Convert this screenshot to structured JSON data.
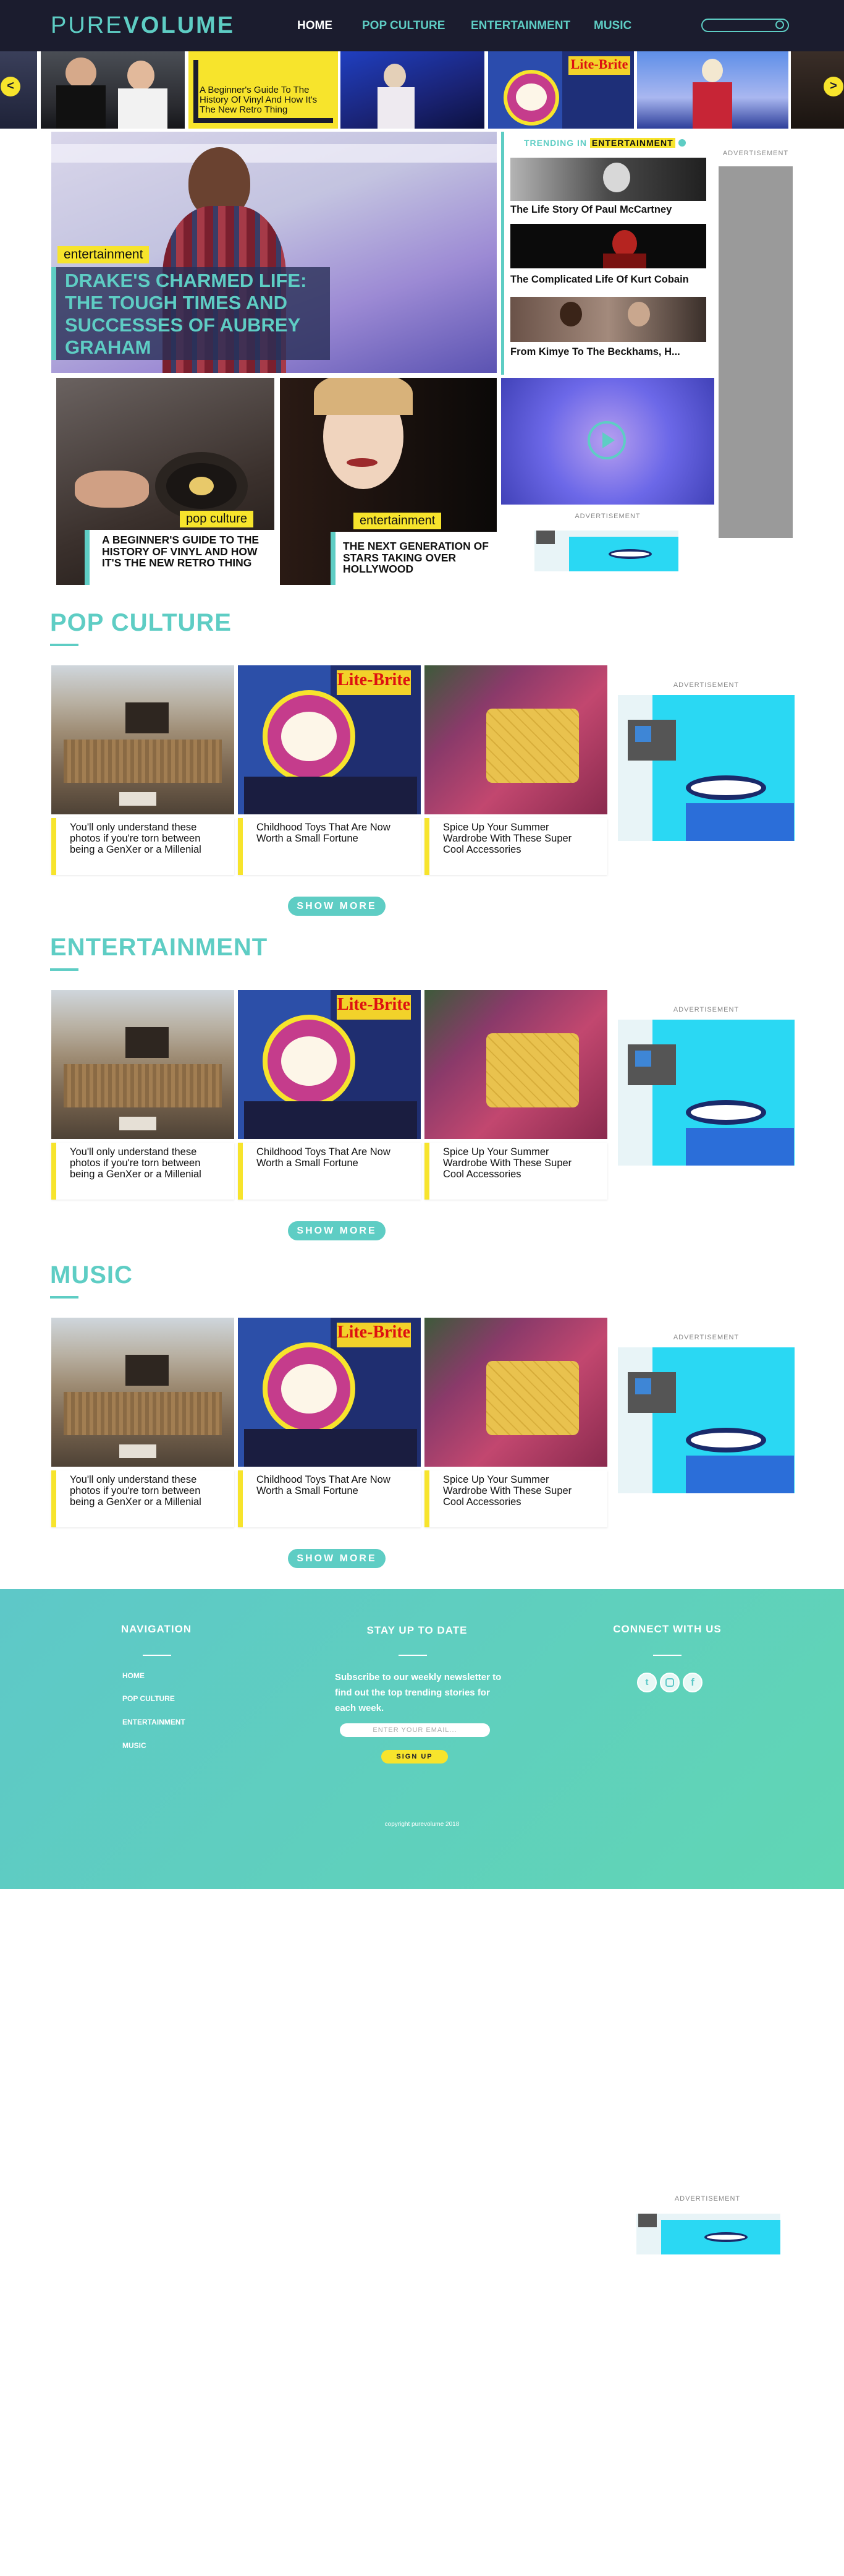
{
  "header": {
    "logo_light": "PURE",
    "logo_bold": "VOLUME",
    "nav": [
      "HOME",
      "POP CULTURE",
      "ENTERTAINMENT",
      "MUSIC"
    ]
  },
  "carousel": {
    "caption": "A Beginner's Guide To The History Of Vinyl And How It's The New Retro Thing",
    "prev": "<",
    "next": ">"
  },
  "hero": {
    "tag": "entertainment",
    "title": "DRAKE'S CHARMED LIFE: THE TOUGH TIMES AND SUCCESSES OF AUBREY GRAHAM"
  },
  "trending": {
    "prefix": "TRENDING IN",
    "category": "ENTERTAINMENT",
    "items": [
      "The Life Story Of Paul McCartney",
      "The Complicated Life Of Kurt Cobain",
      "From Kimye To The Beckhams, H..."
    ]
  },
  "features": [
    {
      "tag": "pop culture",
      "title": "A BEGINNER'S GUIDE TO THE HISTORY OF VINYL AND HOW IT'S THE NEW RETRO THING"
    },
    {
      "tag": "entertainment",
      "title": "THE NEXT GENERATION OF STARS TAKING OVER HOLLYWOOD"
    }
  ],
  "ad_label": "ADVERTISEMENT",
  "sections": [
    {
      "title": "POP CULTURE",
      "cards": [
        "You'll only understand these photos if you're torn between being a GenXer or a Millenial",
        "Childhood Toys That Are Now Worth a Small Fortune",
        "Spice Up Your Summer Wardrobe With These Super Cool Accessories"
      ],
      "more": "SHOW MORE"
    },
    {
      "title": "ENTERTAINMENT",
      "cards": [
        "You'll only understand these photos if you're torn between being a GenXer or a Millenial",
        "Childhood Toys That Are Now Worth a Small Fortune",
        "Spice Up Your Summer Wardrobe With These Super Cool Accessories"
      ],
      "more": "SHOW MORE"
    },
    {
      "title": "MUSIC",
      "cards": [
        "You'll only understand these photos if you're torn between being a GenXer or a Millenial",
        "Childhood Toys That Are Now Worth a Small Fortune",
        "Spice Up Your Summer Wardrobe With These Super Cool Accessories"
      ],
      "more": "SHOW MORE"
    }
  ],
  "footer": {
    "nav_title": "NAVIGATION",
    "nav_links": [
      "HOME",
      "POP CULTURE",
      "ENTERTAINMENT",
      "MUSIC"
    ],
    "stay_title": "STAY UP TO DATE",
    "stay_text": "Subscribe to our weekly newsletter to find out the top trending stories for each week.",
    "email_placeholder": "ENTER YOUR EMAIL...",
    "signup": "SIGN UP",
    "connect_title": "CONNECT WITH US",
    "copyright": "copyright purevolume 2018"
  }
}
